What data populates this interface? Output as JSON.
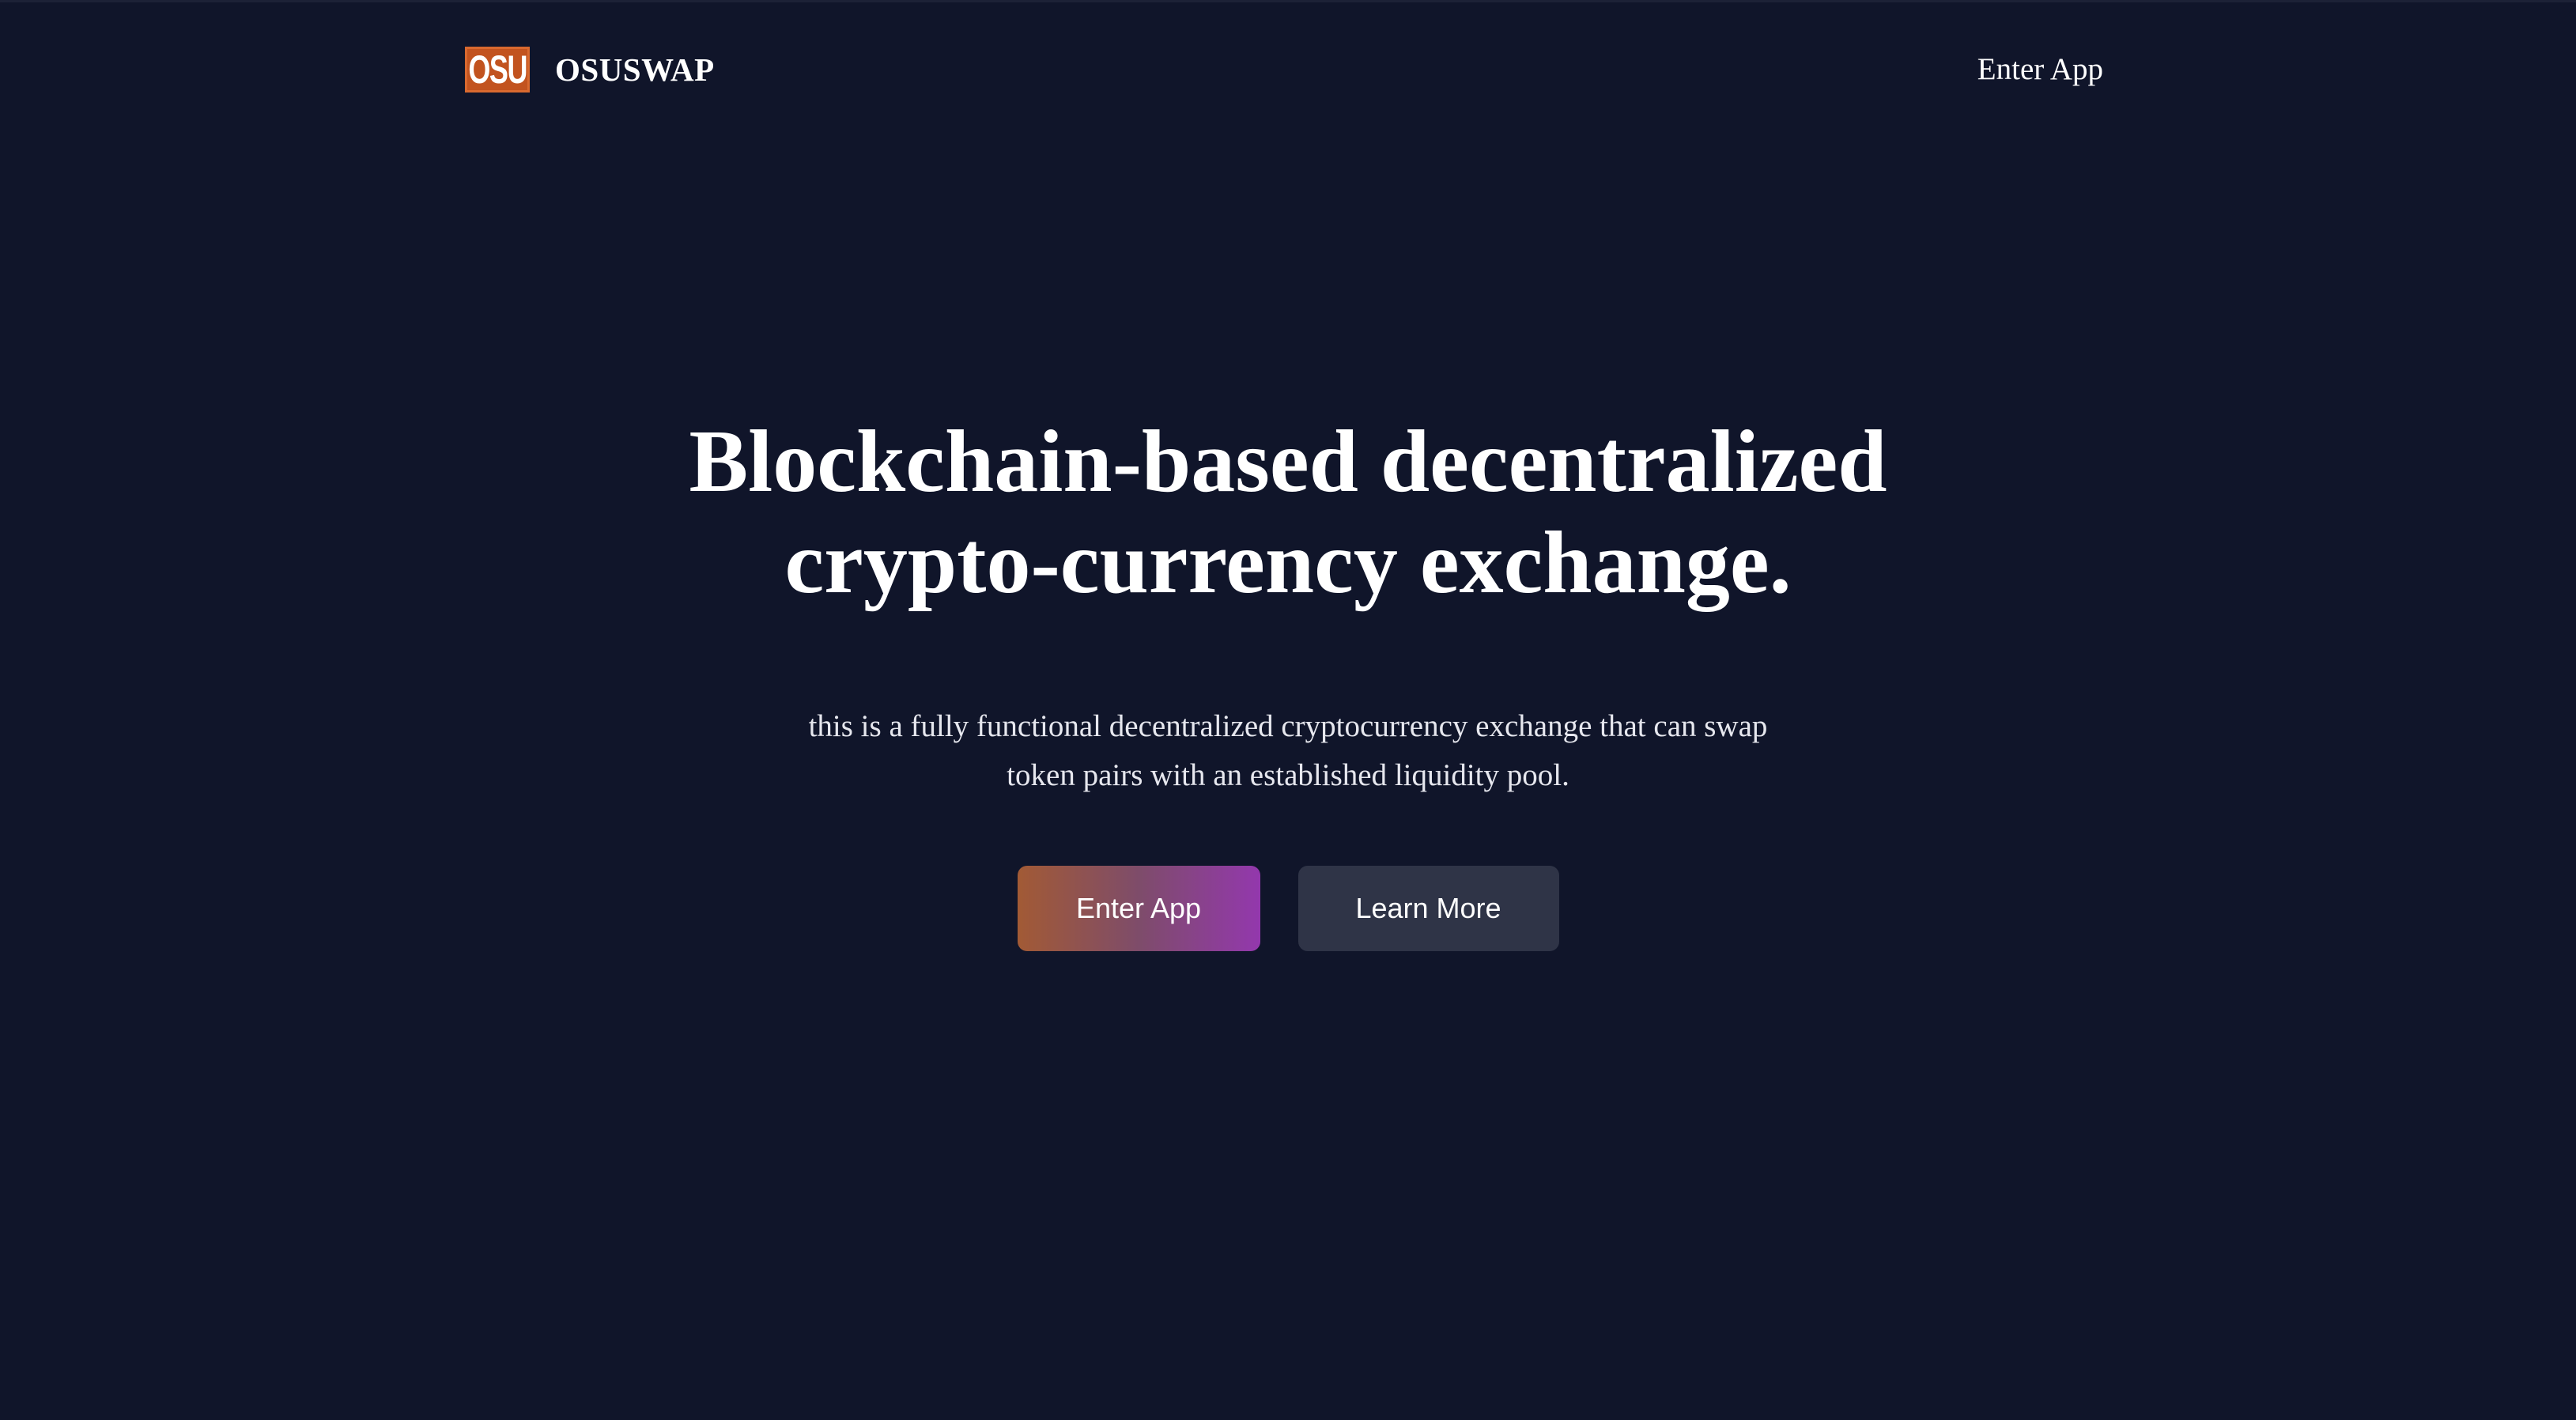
{
  "nav": {
    "logo_text": "OSU",
    "brand": "OSUSWAP",
    "link": "Enter App"
  },
  "hero": {
    "title_line1": "Blockchain-based decentralized",
    "title_line2": "crypto-currency exchange.",
    "description_line1": "this is a fully functional decentralized cryptocurrency exchange that can swap",
    "description_line2": "token pairs with an established liquidity pool."
  },
  "buttons": {
    "primary": "Enter App",
    "secondary": "Learn More"
  },
  "colors": {
    "background": "#10152a",
    "logo": "#c2531f",
    "primary_gradient_start": "#a25a35",
    "primary_gradient_end": "#9338ad",
    "secondary_button": "#2f3447"
  }
}
